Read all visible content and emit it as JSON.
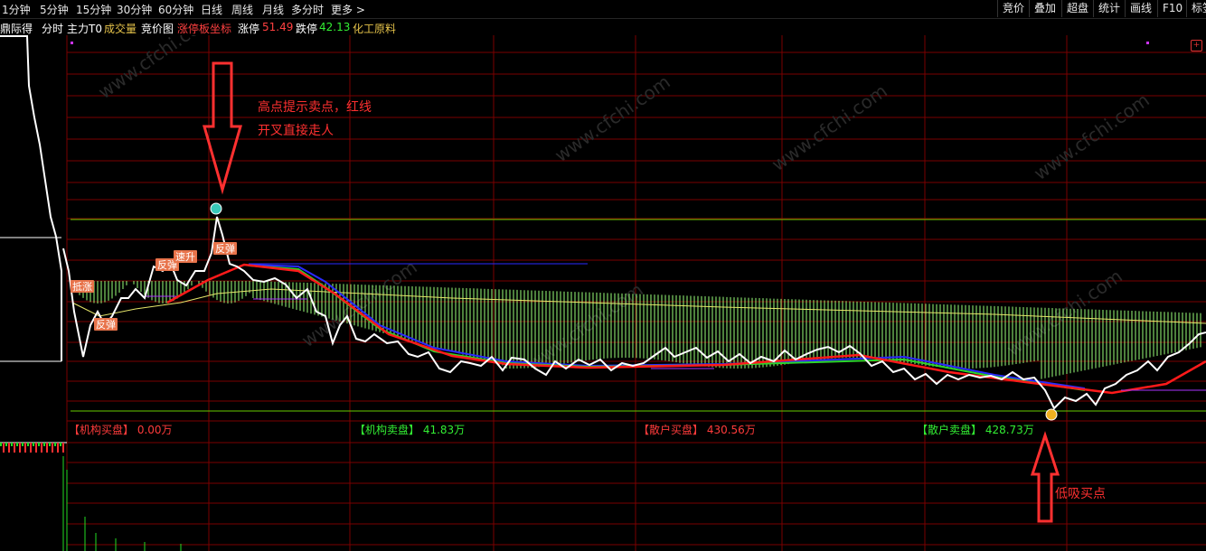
{
  "timeframes": [
    "1分钟",
    "5分钟",
    "15分钟",
    "30分钟",
    "60分钟",
    "日线",
    "周线",
    "月线",
    "多分时",
    "更多 >"
  ],
  "right_buttons": [
    "竞价",
    "叠加",
    "超盘",
    "统计",
    "画线",
    "F10",
    "标签"
  ],
  "subbar": {
    "name": "鼎际得",
    "tabs": [
      "分时",
      "主力T0"
    ],
    "vol": "成交量",
    "bid": "竞价图",
    "indicator": "涨停板坐标",
    "up_label": "涨停",
    "up_value": "51.49",
    "down_label": "跌停",
    "down_value": "42.13",
    "industry": "化工原料"
  },
  "colors": {
    "bg": "#000000",
    "grid": "#7a0000",
    "price": "#ffffff",
    "avg": "#e6e66a",
    "histogram": "#9aff7a",
    "ma_red": "#ff1a1a",
    "ma_green": "#2bd52b",
    "ma_blue": "#2a2aff",
    "level": "#66cc00",
    "annotation": "#ff3030",
    "label_bg": "#e8734a"
  },
  "annotations": {
    "sell_text_1": "高点提示卖点，红线",
    "sell_text_2": "开叉直接走人",
    "buy_text": "低吸买点"
  },
  "signals": [
    {
      "text": "抵涨"
    },
    {
      "text": "反弹"
    },
    {
      "text": "反弹"
    },
    {
      "text": "速升"
    },
    {
      "text": "反弹"
    }
  ],
  "flows": [
    {
      "label": "【机构买盘】",
      "value": "0.00万",
      "color": "#ff3b3b"
    },
    {
      "label": "【机构卖盘】",
      "value": "41.83万",
      "color": "#33ee33"
    },
    {
      "label": "【散户买盘】",
      "value": "430.56万",
      "color": "#ff3b3b"
    },
    {
      "label": "【散户卖盘】",
      "value": "428.73万",
      "color": "#33ee33"
    }
  ],
  "watermark": "www.cfchi.com"
}
